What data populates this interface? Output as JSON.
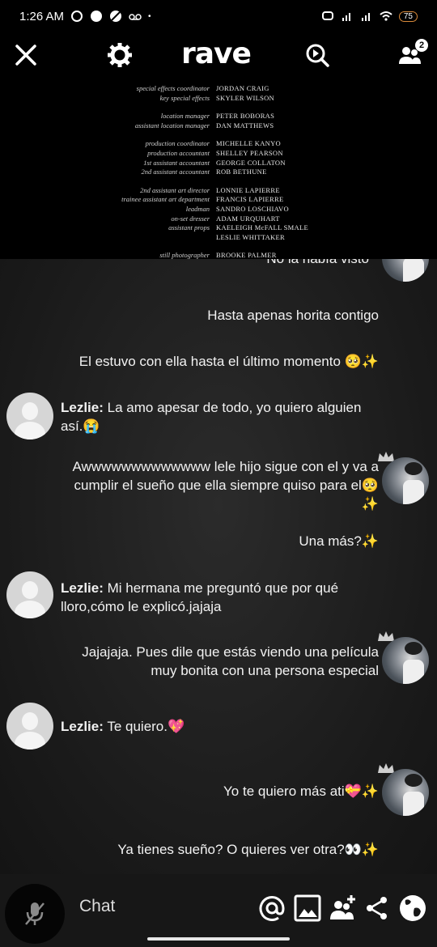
{
  "status_bar": {
    "time": "1:26 AM",
    "battery": "75"
  },
  "header": {
    "logo": "rave",
    "participants_badge": "2"
  },
  "video": {
    "credits": [
      {
        "role": "special effects coordinator",
        "name": "JORDAN CRAIG"
      },
      {
        "role": "key special effects",
        "name": "SKYLER WILSON"
      },
      {
        "gap": true
      },
      {
        "role": "location manager",
        "name": "PETER BOBORAS"
      },
      {
        "role": "assistant location manager",
        "name": "DAN MATTHEWS"
      },
      {
        "gap": true
      },
      {
        "role": "production coordinator",
        "name": "MICHELLE KANYO"
      },
      {
        "role": "production accountant",
        "name": "SHELLEY PEARSON"
      },
      {
        "role": "1st assistant accountant",
        "name": "GEORGE COLLATON"
      },
      {
        "role": "2nd assistant accountant",
        "name": "ROB BETHUNE"
      },
      {
        "gap": true
      },
      {
        "role": "2nd assistant art director",
        "name": "LONNIE LAPIERRE"
      },
      {
        "role": "trainee assistant art department",
        "name": "FRANCIS LAPIERRE"
      },
      {
        "role": "leadman",
        "name": "SANDRO LOSCHIAVO"
      },
      {
        "role": "on-set dresser",
        "name": "ADAM URQUHART"
      },
      {
        "role": "assistant props",
        "name": "KAELEIGH McFALL SMALE"
      },
      {
        "role": "",
        "name": "LESLIE WHITTAKER"
      },
      {
        "gap": true
      },
      {
        "role": "still photographer",
        "name": "BROOKE PALMER"
      }
    ]
  },
  "messages": {
    "m0": {
      "text": "No la había visto"
    },
    "m1": {
      "text": "Hasta apenas horita contigo"
    },
    "m2": {
      "text": "El estuvo con ella hasta el último momento 🥺✨"
    },
    "m3": {
      "sender": "Lezlie:",
      "text": "La amo apesar de todo, yo quiero alguien así.😭"
    },
    "m4": {
      "line1": "Awwwwwwwwwwwww lele hijo sigue con el y va a",
      "line2": "cumplir el sueño que ella siempre quiso para el🥺",
      "line3": "✨"
    },
    "m5": {
      "text": "Una más?✨"
    },
    "m6": {
      "sender": "Lezlie:",
      "text": "Mi hermana me preguntó que por qué lloro,cómo le explicó.jajaja"
    },
    "m7": {
      "line1": "Jajajaja. Pues dile que estás viendo una película",
      "line2": "muy bonita con una persona especial"
    },
    "m8": {
      "sender": "Lezlie:",
      "text": "Te quiero.💖"
    },
    "m9": {
      "text": "Yo te quiero más ati💝✨"
    },
    "m10": {
      "text": "Ya tienes sueño? O quieres ver otra?👀✨"
    }
  },
  "composer": {
    "placeholder": "Chat"
  },
  "colors": {
    "background": "#1c1c1c",
    "text": "#f2f2f2",
    "battery_ring": "#d98a3a"
  }
}
